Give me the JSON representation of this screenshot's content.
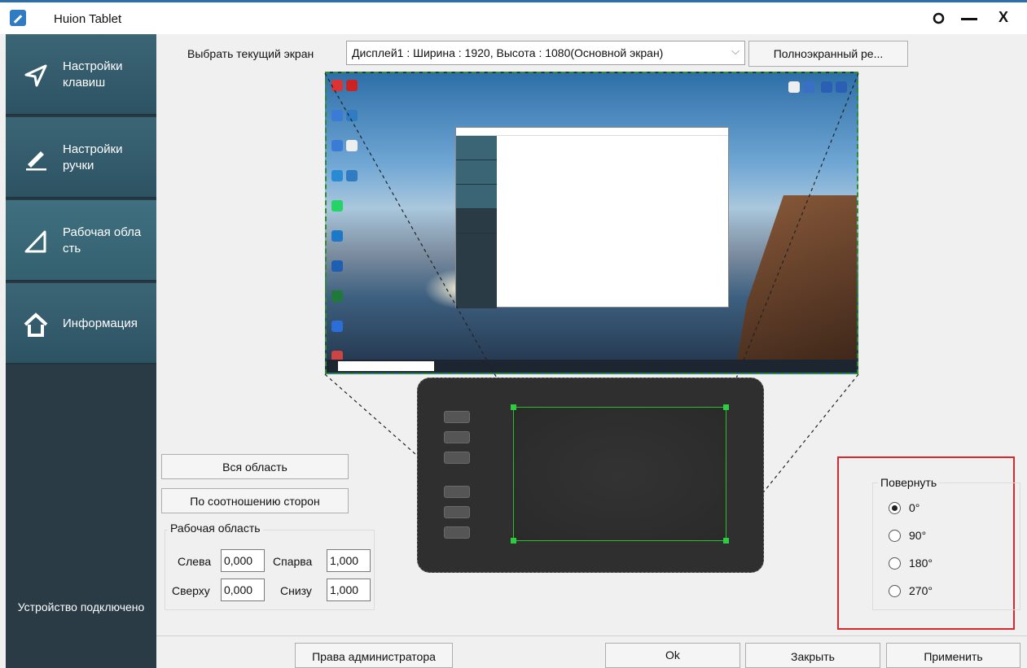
{
  "window": {
    "title": "Huion Tablet"
  },
  "sidebar": {
    "items": [
      {
        "label": "Настройки клавиш"
      },
      {
        "label": "Настройки ручки"
      },
      {
        "label": "Рабочая обла сть"
      },
      {
        "label": "Информация"
      }
    ],
    "status": "Устройство подключено"
  },
  "screen": {
    "label": "Выбрать текущий экран",
    "selected": "Дисплей1 : Ширина : 1920, Высота : 1080(Основной экран)",
    "fullscreen_label": "Полноэкранный ре..."
  },
  "area_buttons": {
    "full": "Вся область",
    "ratio": "По соотношению сторон"
  },
  "work_area": {
    "title": "Рабочая область",
    "left_label": "Слева",
    "left_value": "0,000",
    "right_label": "Спарва",
    "right_value": "1,000",
    "top_label": "Сверху",
    "top_value": "0,000",
    "bottom_label": "Снизу",
    "bottom_value": "1,000"
  },
  "rotate": {
    "title": "Повернуть",
    "options": [
      "0°",
      "90°",
      "180°",
      "270°"
    ],
    "selected": "0°"
  },
  "footer": {
    "admin_label": "Права администратора",
    "ok_label": "Ok",
    "close_label": "Закрыть",
    "apply_label": "Применить"
  },
  "colors": {
    "sidebar": "#2a3b46",
    "nav": "#3b6575",
    "highlight": "#d9272e",
    "area": "#29c129"
  }
}
